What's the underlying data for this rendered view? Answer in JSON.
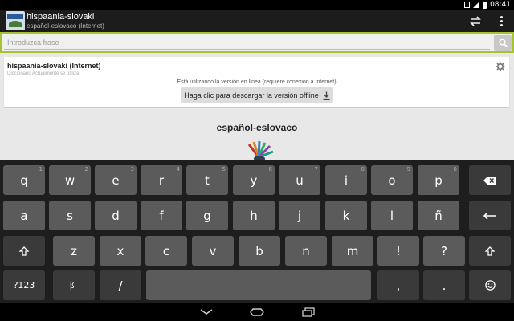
{
  "status_bar": {
    "time": "08:41"
  },
  "header": {
    "title": "hispaania-slovaki",
    "subtitle": "español-eslovaco (Internet)"
  },
  "search": {
    "placeholder": "Introduzca frase",
    "value": ""
  },
  "dictionary_card": {
    "title": "hispaania-slovaki (Internet)",
    "subtitle": "Diccionario Actualmente se utiliza",
    "notice": "Está utilizando la versión en línea (requiere conexión a Internet)",
    "download_label": "Haga clic para descargar la versión offline"
  },
  "main": {
    "heading": "español-eslovaco"
  },
  "keyboard": {
    "row1": [
      {
        "label": "q",
        "hint": "1"
      },
      {
        "label": "w",
        "hint": "2"
      },
      {
        "label": "e",
        "hint": "3"
      },
      {
        "label": "r",
        "hint": "4"
      },
      {
        "label": "t",
        "hint": "5"
      },
      {
        "label": "y",
        "hint": "6"
      },
      {
        "label": "u",
        "hint": "7"
      },
      {
        "label": "i",
        "hint": "8"
      },
      {
        "label": "o",
        "hint": "9"
      },
      {
        "label": "p",
        "hint": "0"
      }
    ],
    "row2": [
      "a",
      "s",
      "d",
      "f",
      "g",
      "h",
      "j",
      "k",
      "l",
      "ñ"
    ],
    "row3": [
      "z",
      "x",
      "c",
      "v",
      "b",
      "n",
      "m",
      "!",
      "?"
    ],
    "symbols_label": "?123",
    "comma_label": ",",
    "period_label": ".",
    "slash_label": "/",
    "lang_label": "阝"
  }
}
